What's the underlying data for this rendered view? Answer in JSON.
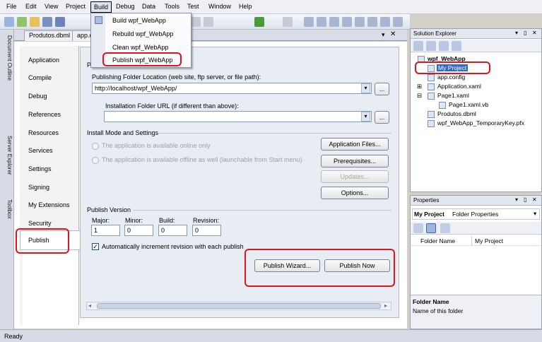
{
  "menubar": {
    "items": [
      "File",
      "Edit",
      "View",
      "Project",
      "Build",
      "Debug",
      "Data",
      "Tools",
      "Test",
      "Window",
      "Help"
    ]
  },
  "build_menu": {
    "items": [
      "Build wpf_WebApp",
      "Rebuild wpf_WebApp",
      "Clean wpf_WebApp",
      "Publish wpf_WebApp"
    ]
  },
  "doc_tabs": [
    "Produtos.dbml",
    "app.c"
  ],
  "left_strip": [
    "Document Outline",
    "Server Explorer",
    "Toolbox"
  ],
  "nav": {
    "items": [
      "Application",
      "Compile",
      "Debug",
      "References",
      "Resources",
      "Services",
      "Settings",
      "Signing",
      "My Extensions",
      "Security",
      "Publish"
    ],
    "active": "Publish"
  },
  "publish": {
    "section_header": "P",
    "folder_location_label": "Publishing Folder Location (web site, ftp server, or file path):",
    "folder_location_value": "http://localhost/wpf_WebApp/",
    "install_url_label": "Installation Folder URL (if different than above):",
    "install_url_value": "",
    "browse_label": "...",
    "install_mode_header": "Install Mode and Settings",
    "radio_online": "The application is available online only",
    "radio_offline": "The application is available offline as well (launchable from Start menu)",
    "btn_application_files": "Application Files...",
    "btn_prerequisites": "Prerequisites...",
    "btn_updates": "Updates...",
    "btn_options": "Options...",
    "version_header": "Publish Version",
    "major_label": "Major:",
    "minor_label": "Minor:",
    "build_label": "Build:",
    "revision_label": "Revision:",
    "major": "1",
    "minor": "0",
    "build": "0",
    "revision": "0",
    "auto_increment_label": "Automatically increment revision with each publish",
    "auto_increment_checked": true,
    "btn_publish_wizard": "Publish Wizard...",
    "btn_publish_now": "Publish Now"
  },
  "solution_explorer": {
    "title": "Solution Explorer",
    "project": "wpf_WebApp",
    "items": [
      "My Project",
      "app.config",
      "Application.xaml",
      "Page1.xaml",
      "Page1.xaml.vb",
      "Produtos.dbml",
      "wpf_WebApp_TemporaryKey.pfx"
    ]
  },
  "properties": {
    "title": "Properties",
    "object_name": "My Project",
    "object_type": "Folder Properties",
    "rows": [
      {
        "name": "Folder Name",
        "value": "My Project"
      }
    ],
    "desc_title": "Folder Name",
    "desc_text": "Name of this folder"
  },
  "statusbar": {
    "text": "Ready"
  },
  "colors": {
    "highlight_red": "#e0141e",
    "selection_blue": "#3169c6"
  }
}
